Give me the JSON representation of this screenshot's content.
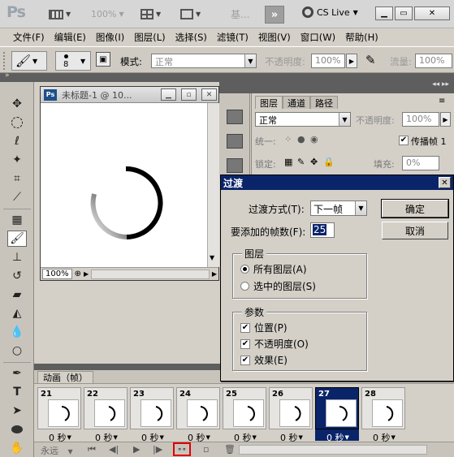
{
  "app": {
    "logo": "Ps",
    "zoom": "100%",
    "workspace": "基...",
    "cslive": "CS Live"
  },
  "menu": [
    "文件(F)",
    "编辑(E)",
    "图像(I)",
    "图层(L)",
    "选择(S)",
    "滤镜(T)",
    "视图(V)",
    "窗口(W)",
    "帮助(H)"
  ],
  "options": {
    "brush_size": "8",
    "mode_label": "模式:",
    "mode_value": "正常",
    "opacity_label": "不透明度:",
    "opacity_value": "100%",
    "flow_label": "流量:",
    "flow_value": "100%"
  },
  "document": {
    "title": "未标题-1 @ 10...",
    "zoom": "100%"
  },
  "layers_panel": {
    "tabs": [
      "图层",
      "通道",
      "路径"
    ],
    "blend": "正常",
    "opacity_label": "不透明度:",
    "opacity_value": "100%",
    "unify_label": "统一:",
    "propagate_label": "传播帧 1",
    "lock_label": "锁定:",
    "fill_label": "填充:",
    "fill_value": "0%"
  },
  "dialog": {
    "title": "过渡",
    "tween_with_label": "过渡方式(T):",
    "tween_with_value": "下一帧",
    "frames_label": "要添加的帧数(F):",
    "frames_value": "25",
    "ok": "确定",
    "cancel": "取消",
    "layers_group": "图层",
    "all_layers": "所有图层(A)",
    "selected_layers": "选中的图层(S)",
    "params_group": "参数",
    "position": "位置(P)",
    "opacity": "不透明度(O)",
    "effects": "效果(E)"
  },
  "animation": {
    "tab": "动画（帧）",
    "loop": "永远",
    "frames": [
      {
        "num": "21",
        "delay": "0 秒"
      },
      {
        "num": "22",
        "delay": "0 秒"
      },
      {
        "num": "23",
        "delay": "0 秒"
      },
      {
        "num": "24",
        "delay": "0 秒"
      },
      {
        "num": "25",
        "delay": "0 秒"
      },
      {
        "num": "26",
        "delay": "0 秒"
      },
      {
        "num": "27",
        "delay": "0 秒"
      },
      {
        "num": "28",
        "delay": "0 秒"
      }
    ],
    "selected_frame": "27"
  }
}
